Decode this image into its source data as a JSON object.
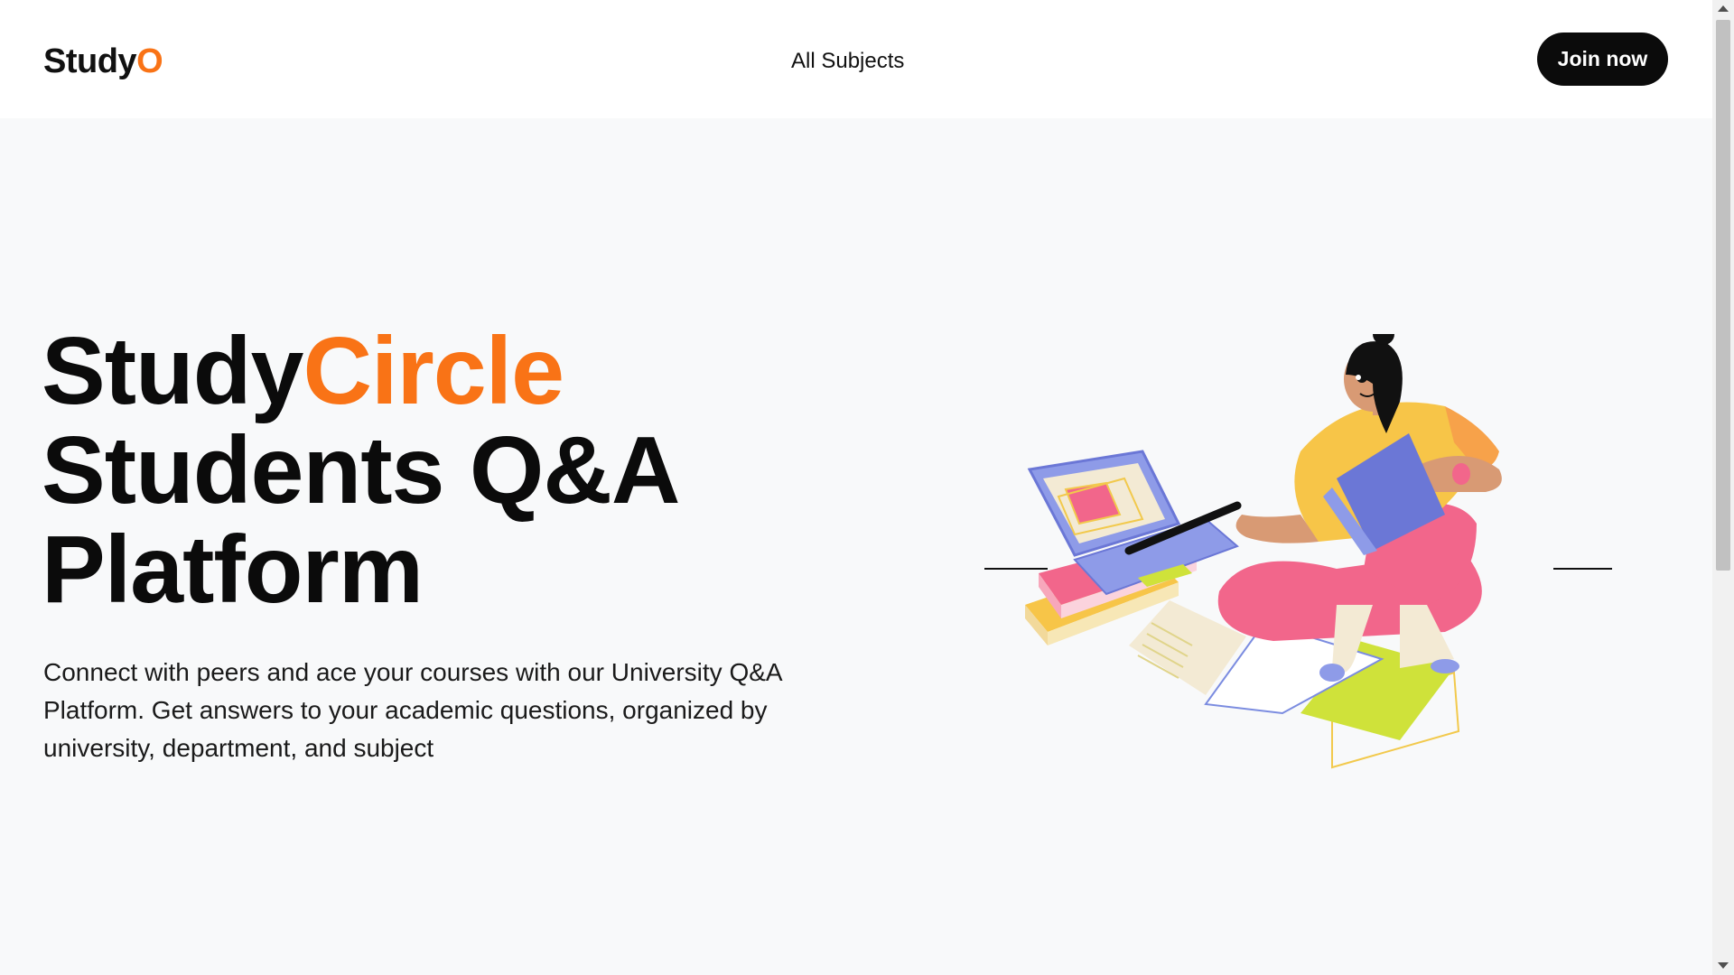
{
  "header": {
    "logo_main": "Study",
    "logo_accent": "O",
    "nav_all_subjects": "All Subjects",
    "join_label": "Join now"
  },
  "hero": {
    "title_part1": "Study",
    "title_part2": "Circle",
    "title_line2": "Students Q&A",
    "title_line3": "Platform",
    "description": "Connect with peers and ace your courses with our University Q&A Platform. Get answers to your academic questions, organized by university, department, and subject"
  },
  "colors": {
    "accent": "#f97316",
    "text": "#0b0b0b",
    "background": "#f8f9fa",
    "button": "#0b0b0b"
  },
  "icons": {
    "illustration": "student-studying-illustration"
  }
}
